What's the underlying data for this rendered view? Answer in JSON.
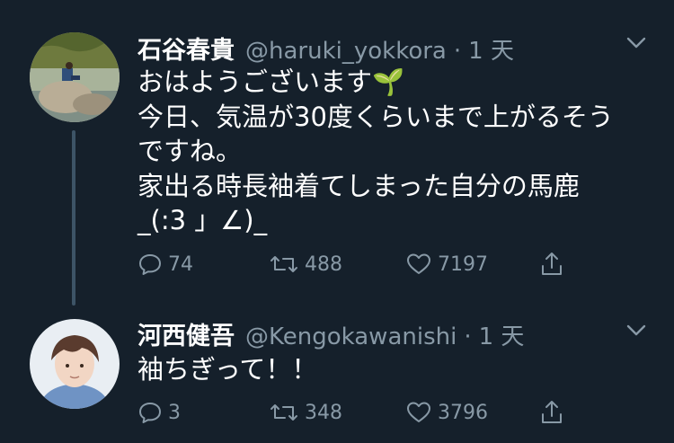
{
  "tweets": [
    {
      "name": "石谷春貴",
      "handle": "@haruki_yokkora",
      "separator": "·",
      "time": "1 天",
      "lines": [
        "おはようございます🌱",
        "今日、気温が30度くらいまで上がるそう",
        "ですね。",
        "家出る時長袖着てしまった自分の馬鹿",
        "_(:3 」∠)_"
      ],
      "replies": "74",
      "retweets": "488",
      "likes": "7197"
    },
    {
      "name": "河西健吾",
      "handle": "@Kengokawanishi",
      "separator": "·",
      "time": "1 天",
      "lines": [
        "袖ちぎって！！"
      ],
      "replies": "3",
      "retweets": "348",
      "likes": "3796"
    }
  ],
  "colors": {
    "background": "#15202b",
    "text_primary": "#ffffff",
    "text_secondary": "#8899a6",
    "thread_line": "#3d5466"
  },
  "icons": [
    "chevron-down-icon",
    "reply-icon",
    "retweet-icon",
    "like-icon",
    "share-icon"
  ]
}
